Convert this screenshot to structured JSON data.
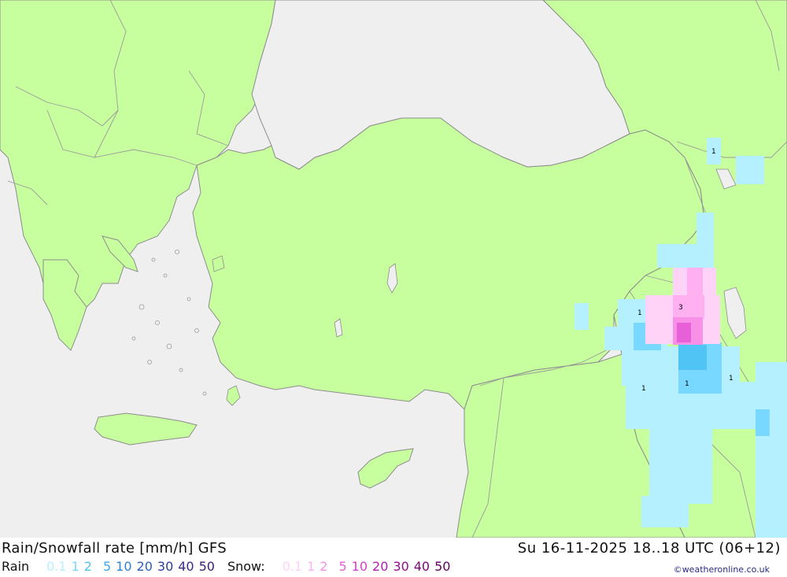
{
  "title": "Rain/Snowfall rate [mm/h] GFS",
  "datetime": "Su 16-11-2025 18..18 UTC (06+12)",
  "credit": "©weatheronline.co.uk",
  "legend": {
    "rain_label": "Rain",
    "rain_levels": [
      {
        "v": "0.1",
        "color": "#b4f0ff"
      },
      {
        "v": "1",
        "color": "#78d8ff"
      },
      {
        "v": "2",
        "color": "#50c4f5"
      },
      {
        "v": "5",
        "color": "#3ca8e8"
      },
      {
        "v": "10",
        "color": "#2f82d0"
      },
      {
        "v": "20",
        "color": "#2d5fb8"
      },
      {
        "v": "30",
        "color": "#2a3ea0"
      },
      {
        "v": "40",
        "color": "#3a2a88"
      },
      {
        "v": "50",
        "color": "#3a1f70"
      }
    ],
    "snow_label": "Snow:",
    "snow_levels": [
      {
        "v": "0.1",
        "color": "#ffd2f8"
      },
      {
        "v": "1",
        "color": "#ffb0f0"
      },
      {
        "v": "2",
        "color": "#f890e8"
      },
      {
        "v": "5",
        "color": "#e860d8"
      },
      {
        "v": "10",
        "color": "#d040c8"
      },
      {
        "v": "20",
        "color": "#b020b0"
      },
      {
        "v": "30",
        "color": "#901090"
      },
      {
        "v": "40",
        "color": "#780878"
      },
      {
        "v": "50",
        "color": "#600060"
      }
    ]
  },
  "map": {
    "colors": {
      "sea": "#efefef",
      "land": "#c8ff9e",
      "border": "#9a9a9a",
      "coast": "#8c8c8c"
    },
    "cell_labels": [
      "1",
      "3",
      "1",
      "1",
      "1",
      "1",
      "1"
    ]
  }
}
